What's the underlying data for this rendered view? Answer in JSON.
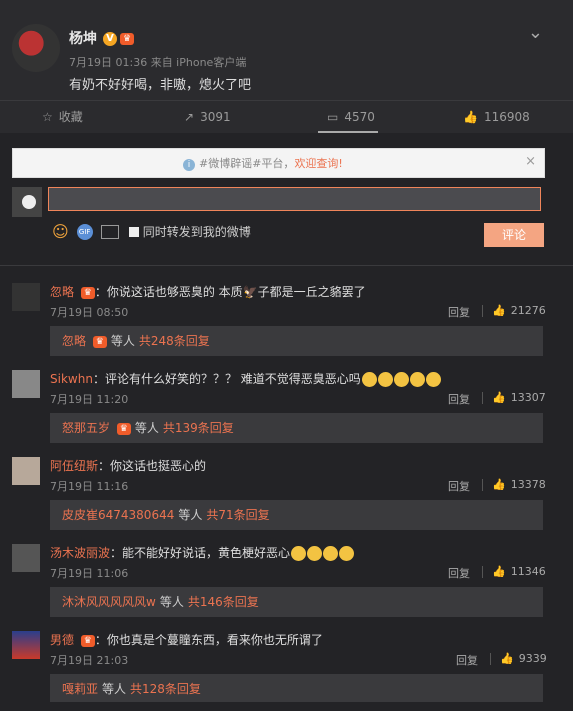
{
  "post": {
    "username": "杨坤",
    "badge_v": "V",
    "meta": "7月19日 01:36 来自 iPhone客户端",
    "text": "有奶不好好喝，非嗷，熄火了吧",
    "chevron_icon": "chevron-down-icon"
  },
  "actions": {
    "favorite": "收藏",
    "forward": "3091",
    "comment": "4570",
    "like": "116908"
  },
  "notice": {
    "prefix": "#微博辟谣#平台，",
    "link": "欢迎查询!",
    "close": "×"
  },
  "composer": {
    "input_value": "",
    "forward_label": "同时转发到我的微博",
    "submit_label": "评论"
  },
  "comments": [
    {
      "user": "忽略",
      "text": "：你说这话也够恶臭的 本质",
      "text2": "子都是一丘之貉罢了",
      "time": "7月19日 08:50",
      "reply": "回复",
      "likes": "21276",
      "sub_name": "忽略",
      "sub_etc": "等人",
      "sub_more": "共248条回复"
    },
    {
      "user": "Sikwhn",
      "text": "：评论有什么好笑的？？？ 难道不觉得恶臭恶心吗",
      "time": "7月19日 11:20",
      "reply": "回复",
      "likes": "13307",
      "sub_name": "怒那五岁",
      "sub_etc": "等人",
      "sub_more": "共139条回复"
    },
    {
      "user": "阿伍纽斯",
      "text": "：你这话也挺恶心的",
      "time": "7月19日 11:16",
      "reply": "回复",
      "likes": "13378",
      "sub_name": "皮皮崔6474380644",
      "sub_etc": "等人",
      "sub_more": "共71条回复"
    },
    {
      "user": "汤木波丽波",
      "text": "：能不能好好说话，黄色梗好恶心",
      "time": "7月19日 11:06",
      "reply": "回复",
      "likes": "11346",
      "sub_name": "沐沐风风风风风w",
      "sub_etc": "等人",
      "sub_more": "共146条回复"
    },
    {
      "user": "男德",
      "text": "：你也真是个蔓瞳东西，看来你也无所谓了",
      "time": "7月19日 21:03",
      "reply": "回复",
      "likes": "9339",
      "sub_name": "嘎莉亚",
      "sub_etc": "等人",
      "sub_more": "共128条回复"
    }
  ],
  "colors": {
    "accent": "#eb7350",
    "background": "#232326"
  }
}
